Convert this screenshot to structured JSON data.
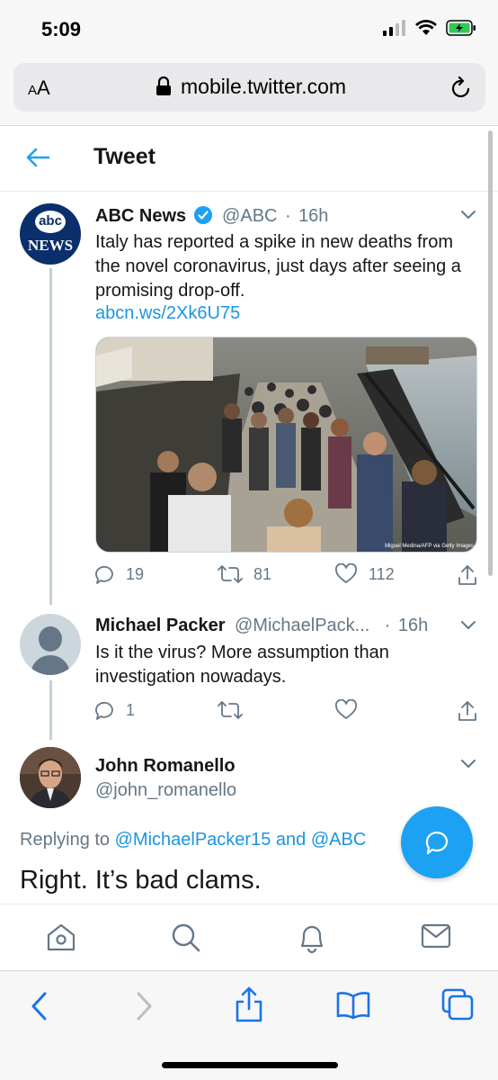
{
  "status": {
    "time": "5:09"
  },
  "browser": {
    "aa": "AA",
    "url": "mobile.twitter.com"
  },
  "header": {
    "title": "Tweet"
  },
  "tweets": [
    {
      "name": "ABC News",
      "handle": "@ABC",
      "separator": "·",
      "time": "16h",
      "text": "Italy has reported a spike in new deaths from the novel coronavirus, just days after seeing a promising drop-off.",
      "link": "abcn.ws/2Xk6U75",
      "media_credit": "Miguel Medina/AFP via Getty Images",
      "replies": "19",
      "retweets": "81",
      "likes": "112",
      "avatar_text": {
        "top": "abc",
        "bottom": "NEWS"
      }
    },
    {
      "name": "Michael Packer",
      "handle": "@MichaelPack...",
      "separator": "·",
      "time": "16h",
      "text": "Is it the virus? More assumption than investigation nowadays.",
      "replies": "1"
    },
    {
      "name": "John Romanello",
      "handle": "@john_romanello",
      "replying_prefix": "Replying to",
      "replying_user1": "@MichaelPacker15",
      "replying_and": "and",
      "replying_user2": "@ABC",
      "text": "Right. It’s bad clams."
    }
  ],
  "colors": {
    "accent": "#1da1f2",
    "link": "#1b95e0",
    "muted": "#657786",
    "safari_blue": "#1a73e8"
  }
}
